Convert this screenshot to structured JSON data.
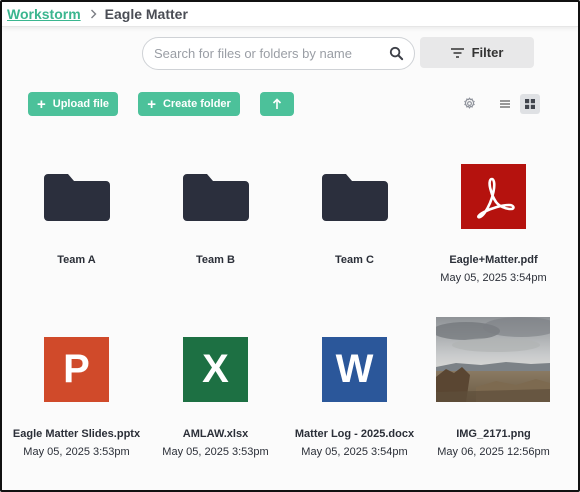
{
  "breadcrumb": {
    "root": "Workstorm",
    "current": "Eagle Matter"
  },
  "search": {
    "placeholder": "Search for files or folders by name",
    "value": ""
  },
  "toolbar": {
    "filter_label": "Filter",
    "upload_label": "Upload file",
    "create_folder_label": "Create folder"
  },
  "colors": {
    "accent": "#4cc19a",
    "folder": "#2b2f3d",
    "pdf": "#b5120e",
    "powerpoint": "#d04a2a",
    "excel": "#1d7043",
    "word": "#2b579a"
  },
  "items": [
    {
      "name": "Team A",
      "date": "",
      "icon": "folder-icon"
    },
    {
      "name": "Team B",
      "date": "",
      "icon": "folder-icon"
    },
    {
      "name": "Team C",
      "date": "",
      "icon": "folder-icon"
    },
    {
      "name": "Eagle+Matter.pdf",
      "date": "May 05, 2025 3:54pm",
      "icon": "pdf-icon"
    },
    {
      "name": "Eagle Matter Slides.pptx",
      "date": "May 05, 2025 3:53pm",
      "icon": "powerpoint-icon",
      "letter": "P"
    },
    {
      "name": "AMLAW.xlsx",
      "date": "May 05, 2025 3:53pm",
      "icon": "excel-icon",
      "letter": "X"
    },
    {
      "name": "Matter Log - 2025.docx",
      "date": "May 05, 2025 3:54pm",
      "icon": "word-icon",
      "letter": "W"
    },
    {
      "name": "IMG_2171.png",
      "date": "May 06, 2025 12:56pm",
      "icon": "image-thumbnail"
    }
  ]
}
